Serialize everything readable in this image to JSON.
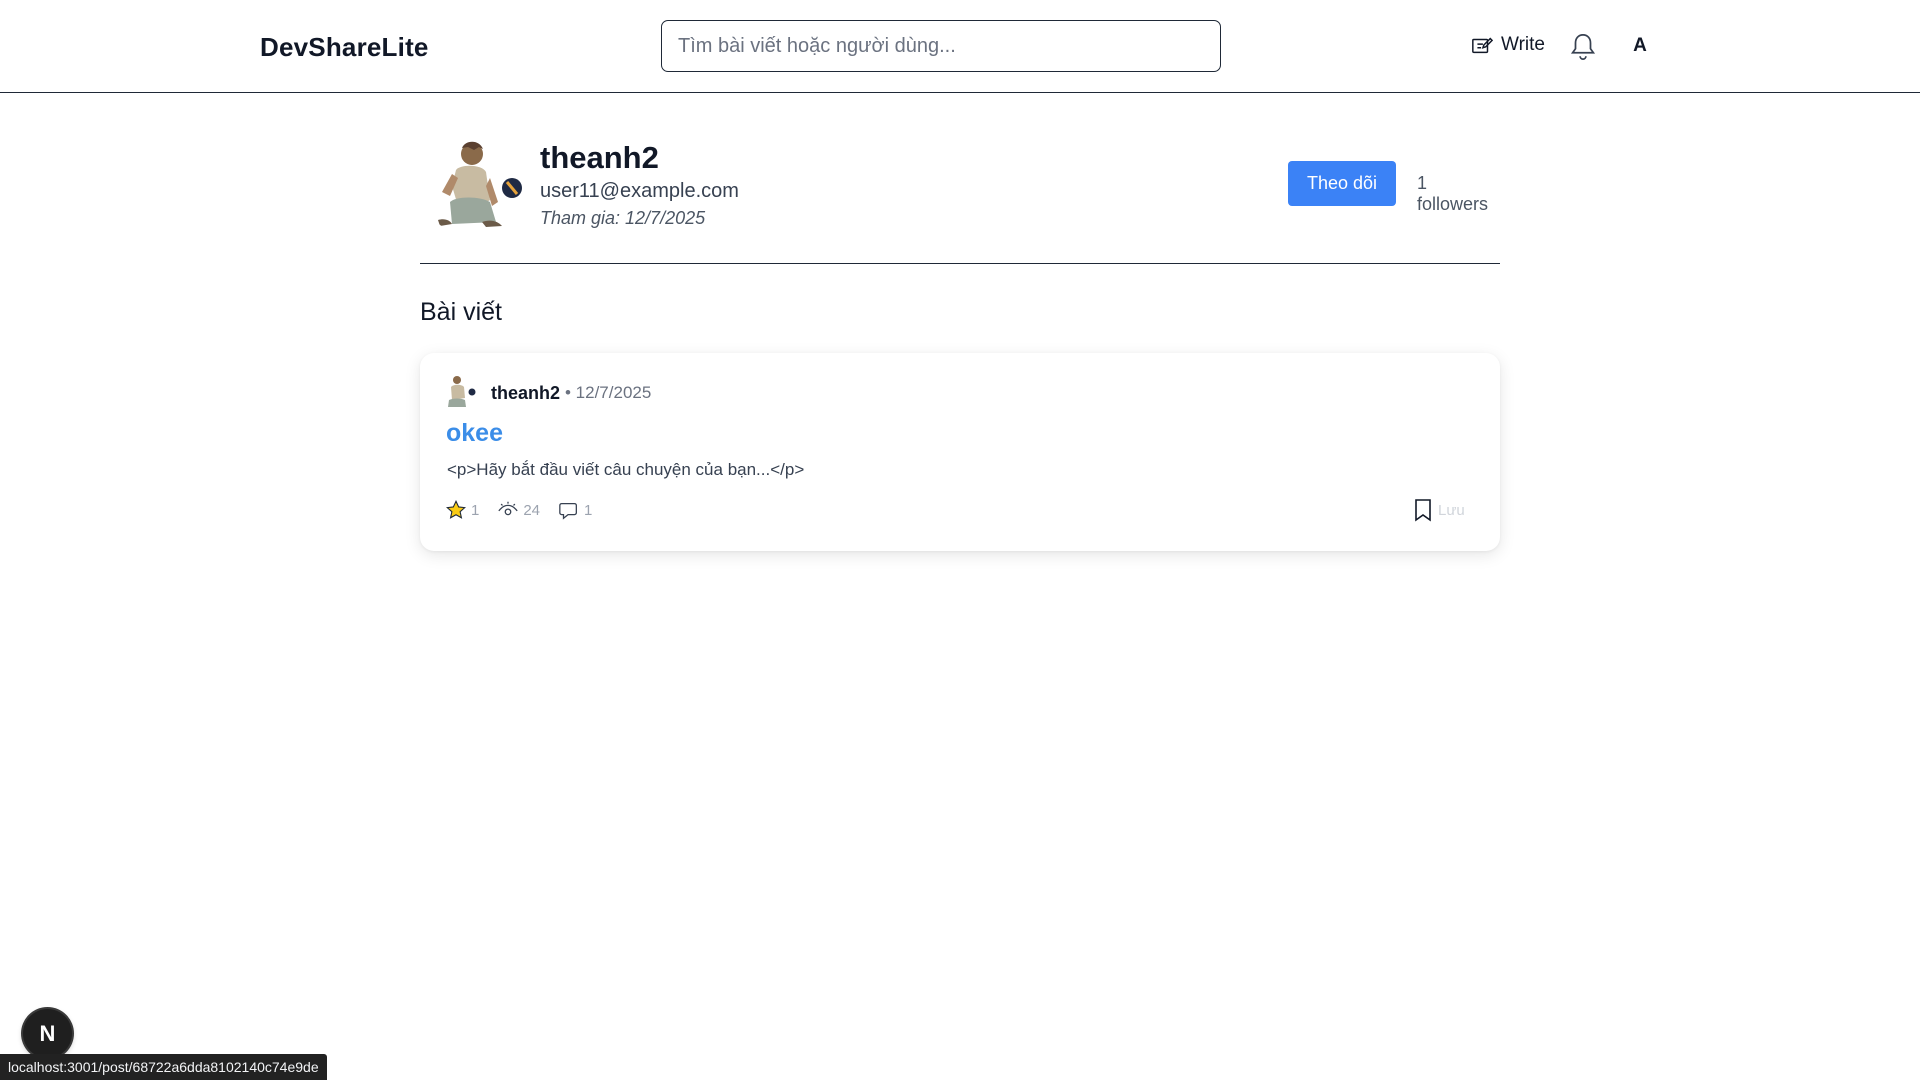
{
  "nav": {
    "brand": "DevShareLite",
    "search_placeholder": "Tìm bài viết hoặc người dùng...",
    "write_label": "Write",
    "avatar_initial": "A"
  },
  "profile": {
    "username": "theanh2",
    "email": "user11@example.com",
    "joined": "Tham gia: 12/7/2025",
    "follow_label": "Theo dõi",
    "followers": "1 followers"
  },
  "posts_section": {
    "title": "Bài viết",
    "posts": [
      {
        "author": "theanh2",
        "date": "• 12/7/2025",
        "title": "okee",
        "excerpt": "<p>Hãy bắt đầu viết câu chuyện của bạn...</p>",
        "stars": "1",
        "views": "24",
        "comments": "1",
        "save_label": "Lưu"
      }
    ]
  },
  "dev": {
    "badge": "N",
    "status_url": "localhost:3001/post/68722a6dda8102140c74e9de"
  },
  "colors": {
    "accent": "#3b82f6",
    "title_link": "#3b8de8",
    "star": "#facc15"
  }
}
